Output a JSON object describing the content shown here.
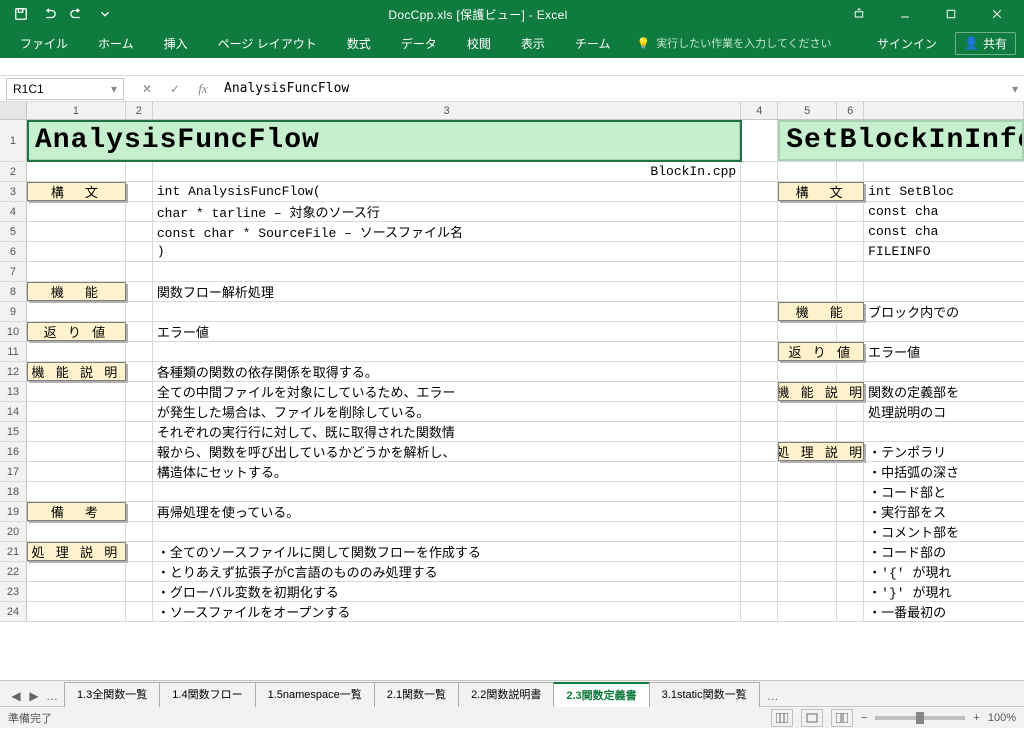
{
  "title": "DocCpp.xls [保護ビュー] - Excel",
  "ribbon": {
    "tabs": [
      "ファイル",
      "ホーム",
      "挿入",
      "ページ レイアウト",
      "数式",
      "データ",
      "校閲",
      "表示",
      "チーム"
    ],
    "tellme": "実行したい作業を入力してください",
    "signin": "サインイン",
    "share": "共有"
  },
  "namebox": "R1C1",
  "formula": "AnalysisFuncFlow",
  "columns": [
    "1",
    "2",
    "3",
    "4",
    "5",
    "6"
  ],
  "rows": [
    "1",
    "2",
    "3",
    "4",
    "5",
    "6",
    "7",
    "8",
    "9",
    "10",
    "11",
    "12",
    "13",
    "14",
    "15",
    "16",
    "17",
    "18",
    "19",
    "20",
    "21",
    "22",
    "23",
    "24"
  ],
  "titleLeft": "AnalysisFuncFlow",
  "titleRight": "SetBlockInInfo",
  "labels": {
    "syntax": "構　文",
    "func": "機　能",
    "ret": "返 り 値",
    "desc": "機 能 説 明",
    "note": "備　考",
    "proc": "処 理 説 明"
  },
  "left": {
    "r2c3": "BlockIn.cpp",
    "r3": "int AnalysisFuncFlow(",
    "r4": "  char *       tarline     – 対象のソース行",
    "r5": "  const char * SourceFile  – ソースファイル名",
    "r6": ")",
    "r8": "関数フロー解析処理",
    "r10": "エラー値",
    "r12": "各種類の関数の依存関係を取得する。",
    "r13": "全ての中間ファイルを対象にしているため、エラー",
    "r14": "が発生した場合は、ファイルを削除している。",
    "r15": "それぞれの実行行に対して、既に取得された関数情",
    "r16": "報から、関数を呼び出しているかどうかを解析し、",
    "r17": "構造体にセットする。",
    "r19": "再帰処理を使っている。",
    "r21": "・全てのソースファイルに関して関数フローを作成する",
    "r22": "・とりあえず拡張子がC言語のもののみ処理する",
    "r23": "・グローバル変数を初期化する",
    "r24": "・ソースファイルをオープンする"
  },
  "right": {
    "r3": "int SetBloc",
    "r4": "  const cha",
    "r5": "  const cha",
    "r6": "  FILEINFO ",
    "r9": "ブロック内での",
    "r11": "エラー値",
    "r13": "関数の定義部を",
    "r14": "処理説明のコ",
    "r16": "・テンポラリ",
    "r17": "・中括弧の深さ",
    "r18": "・コード部と",
    "r19": "・実行部をス",
    "r20": "・コメント部を",
    "r21": "・コード部の",
    "r22": "・'{' が現れ",
    "r23": "・'}' が現れ",
    "r24": "・一番最初の"
  },
  "sheetTabs": [
    "1.3全関数一覧",
    "1.4関数フロー",
    "1.5namespace一覧",
    "2.1関数一覧",
    "2.2関数説明書",
    "2.3関数定義書",
    "3.1static関数一覧"
  ],
  "activeTab": 5,
  "status": "準備完了",
  "zoom": "100%"
}
